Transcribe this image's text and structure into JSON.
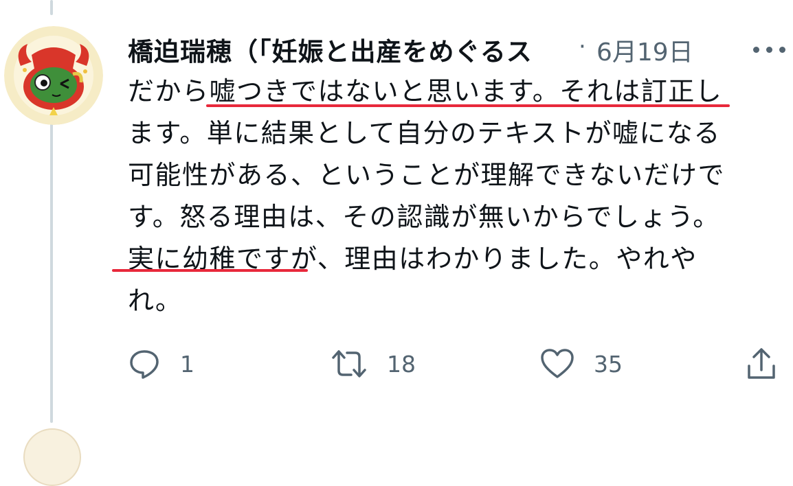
{
  "tweet": {
    "author_name": "橋迫瑞穂（「妊娠と出産をめぐるス",
    "separator": "·",
    "date": "6月19日",
    "text_lines": [
      "だから嘘つきではないと思います。それは訂正し",
      "ます。単に結果として自分のテキストが嘘になる",
      "可能性がある、ということが理解できないだけで",
      "す。怒る理由は、その認識が無いからでしょう。",
      "実に幼稚ですが、理由はわかりました。やれや",
      "れ。"
    ],
    "highlight_color": "#e8283b"
  },
  "actions": {
    "reply_count": "1",
    "retweet_count": "18",
    "like_count": "35"
  },
  "icons": {
    "more": "more-horizontal-icon",
    "reply": "reply-icon",
    "retweet": "retweet-icon",
    "like": "heart-icon",
    "share": "share-icon"
  },
  "colors": {
    "text": "#0f1419",
    "secondary": "#536471",
    "thread_line": "#cfd9de"
  }
}
